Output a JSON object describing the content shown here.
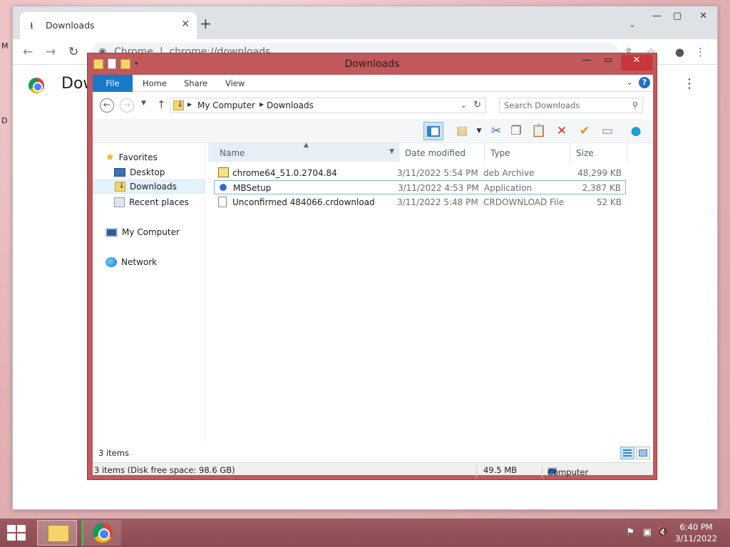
{
  "chrome": {
    "tab_title": "Downloads",
    "omnibox_site": "Chrome",
    "omnibox_url": "chrome://downloads",
    "page_heading": "Dow"
  },
  "explorer": {
    "title": "Downloads",
    "ribbon_tabs": [
      "File",
      "Home",
      "Share",
      "View"
    ],
    "breadcrumb": [
      "My Computer",
      "Downloads"
    ],
    "search_placeholder": "Search Downloads",
    "nav": {
      "favorites": "Favorites",
      "desktop": "Desktop",
      "downloads": "Downloads",
      "recent": "Recent places",
      "computer": "My Computer",
      "network": "Network"
    },
    "columns": {
      "name": "Name",
      "date": "Date modified",
      "type": "Type",
      "size": "Size"
    },
    "files": [
      {
        "name": "chrome64_51.0.2704.84",
        "date": "3/11/2022 5:54 PM",
        "type": "deb Archive",
        "size": "48,299 KB",
        "icon": "deb-archive-icon"
      },
      {
        "name": "MBSetup",
        "date": "3/11/2022 4:53 PM",
        "type": "Application",
        "size": "2,387 KB",
        "icon": "application-icon"
      },
      {
        "name": "Unconfirmed 484066.crdownload",
        "date": "3/11/2022 5:48 PM",
        "type": "CRDOWNLOAD File",
        "size": "52 KB",
        "icon": "blank-file-icon"
      }
    ],
    "item_count": "3 items",
    "status_left": "3 items (Disk free space: 98.6 GB)",
    "status_size": "49.5 MB",
    "status_location": "Computer",
    "colors": {
      "frame": "#c0585c",
      "file_tab": "#1979ca",
      "close": "#c7373b"
    }
  },
  "taskbar": {
    "time": "6:40 PM",
    "date": "3/11/2022"
  }
}
